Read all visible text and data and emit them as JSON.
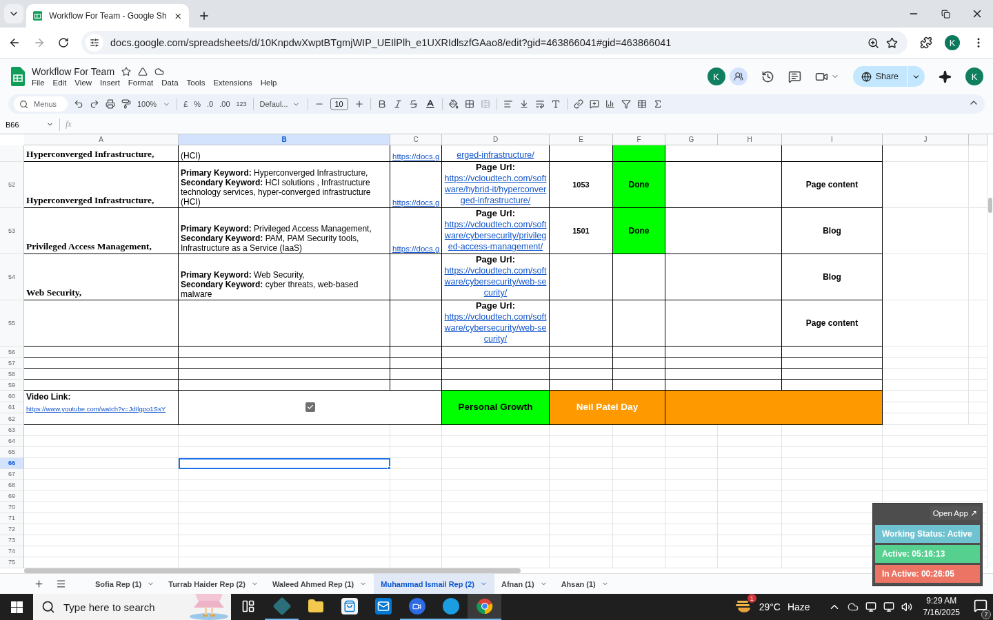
{
  "browser": {
    "tab_title": "Workflow For Team - Google Sh",
    "url": "docs.google.com/spreadsheets/d/10KnpdwXwptBTgmjWIP_UEIlPlh_e1UXRIdlszfGAao8/edit?gid=463866041#gid=463866041",
    "profile": "K"
  },
  "doc": {
    "title": "Workflow For Team",
    "menus": [
      "File",
      "Edit",
      "View",
      "Insert",
      "Format",
      "Data",
      "Tools",
      "Extensions",
      "Help"
    ],
    "collaborator": "K",
    "share": "Share",
    "profile": "K"
  },
  "toolbar": {
    "search_placeholder": "Menus",
    "zoom": "100%",
    "currency": "£",
    "percent": "%",
    "decrease_decimal": ".0",
    "increase_decimal": ".00",
    "number_format": "123",
    "font": "Defaul...",
    "font_size": "10"
  },
  "formula_bar": {
    "cell_ref": "B66",
    "fx": "fx"
  },
  "columns": [
    {
      "label": "A",
      "selected": false
    },
    {
      "label": "B",
      "selected": true
    },
    {
      "label": "C",
      "selected": false
    },
    {
      "label": "D",
      "selected": false
    },
    {
      "label": "E",
      "selected": false
    },
    {
      "label": "F",
      "selected": false
    },
    {
      "label": "G",
      "selected": false
    },
    {
      "label": "H",
      "selected": false
    },
    {
      "label": "I",
      "selected": false
    },
    {
      "label": "J",
      "selected": false
    }
  ],
  "rows": [
    {
      "kind": "tail",
      "selected": false,
      "title": "Hyperconverged Infrastructure,",
      "keywords": [
        "(HCI)"
      ],
      "doc_link": "https://docs.g",
      "page_url": "erged-infrastructure/",
      "status": {
        "color": "#00ff00"
      }
    },
    {
      "kind": "entry",
      "number": "52",
      "selected": false,
      "title": "Hyperconverged Infrastructure,",
      "keywords": [
        "**Primary Keyword:** Hyperconverged Infrastructure,",
        "**Secondary Keyword:** HCI solutions , Infrastructure technology services, hyper-converged infrastructure (HCI)"
      ],
      "doc_link": "https://docs.g",
      "page_url_label": "Page Url:",
      "page_url": "https://vcloudtech.com/software/hybrid-it/hyperconverged-infrastructure/",
      "word_count": "1053",
      "status": {
        "text": "Done",
        "color": "#00ff00"
      },
      "content_type": "Page content"
    },
    {
      "kind": "entry",
      "number": "53",
      "selected": false,
      "title": "Privileged Access Management,",
      "keywords": [
        "**Primary Keyword:** Privileged Access Management,",
        "**Secondary Keyword:** PAM, PAM Security tools, Infrastructure as a Service (IaaS)"
      ],
      "doc_link": "https://docs.g",
      "page_url_label": "Page Url:",
      "page_url": "https://vcloudtech.com/software/cybersecurity/privileged-access-management/",
      "word_count": "1501",
      "status": {
        "text": "Done",
        "color": "#00ff00"
      },
      "content_type": "Blog"
    },
    {
      "kind": "entry",
      "number": "54",
      "selected": false,
      "title": "Web Security,",
      "keywords": [
        "**Primary Keyword:** Web Security,",
        "**Secondary Keyword:** cyber threats, web-based malware"
      ],
      "page_url_label": "Page Url:",
      "page_url": "https://vcloudtech.com/software/cybersecurity/web-security/",
      "content_type": "Blog"
    },
    {
      "kind": "entry",
      "number": "55",
      "selected": false,
      "page_url_label": "Page Url:",
      "page_url": "https://vcloudtech.com/software/cybersecurity/web-security/",
      "content_type": "Page content"
    },
    {
      "kind": "blank",
      "number": "56",
      "selected": false
    },
    {
      "kind": "blank",
      "number": "57",
      "selected": false
    },
    {
      "kind": "blank",
      "number": "58",
      "selected": false
    },
    {
      "kind": "blank",
      "number": "59",
      "selected": false
    },
    {
      "kind": "summary",
      "number": "60",
      "selected": false
    },
    {
      "kind": "summary",
      "number": "61",
      "selected": false
    },
    {
      "kind": "summary",
      "number": "62",
      "selected": false
    },
    {
      "kind": "plain",
      "number": "63",
      "selected": false
    },
    {
      "kind": "plain",
      "number": "64",
      "selected": false
    },
    {
      "kind": "plain",
      "number": "65",
      "selected": false
    },
    {
      "kind": "plain",
      "number": "66",
      "selected": true
    },
    {
      "kind": "plain",
      "number": "67",
      "selected": false
    },
    {
      "kind": "plain",
      "number": "68",
      "selected": false
    },
    {
      "kind": "plain",
      "number": "69",
      "selected": false
    },
    {
      "kind": "plain",
      "number": "70",
      "selected": false
    },
    {
      "kind": "plain",
      "number": "71",
      "selected": false
    },
    {
      "kind": "plain",
      "number": "72",
      "selected": false
    },
    {
      "kind": "plain",
      "number": "73",
      "selected": false
    },
    {
      "kind": "plain",
      "number": "74",
      "selected": false
    },
    {
      "kind": "plain",
      "number": "75",
      "selected": false
    }
  ],
  "summary": {
    "label": "Video Link:",
    "video_url": "https://www.youtube.com/watch?v=JdIlgpo1SsY",
    "checked": true,
    "tags": [
      {
        "text": "Personal Growth",
        "color": "#00ff00"
      },
      {
        "text": "Neil Patel Day",
        "color": "#ff9900"
      }
    ],
    "fill": {
      "color": "#ff9900"
    }
  },
  "sheet_tabs": [
    {
      "label": "Sofia Rep (1)",
      "selected": false
    },
    {
      "label": "Turrab Haider Rep (2)",
      "selected": false
    },
    {
      "label": "Waleed Ahmed Rep (1)",
      "selected": false
    },
    {
      "label": "Muhammad Ismail Rep (2)",
      "selected": true
    },
    {
      "label": "Afnan (1)",
      "selected": false
    },
    {
      "label": "Ahsan (1)",
      "selected": false
    }
  ],
  "tracker": {
    "open_app": "Open App ↗",
    "lines": [
      {
        "text": "Working Status: Active",
        "color": "#6fc2cf"
      },
      {
        "text": "Active: 05:16:13",
        "color": "#55d08f"
      },
      {
        "text": "In Active: 00:26:05",
        "color": "#ec7464"
      }
    ]
  },
  "taskbar": {
    "search_placeholder": "Type here to search",
    "weather_badge": "1",
    "temperature": "29°C",
    "condition": "Haze",
    "time": "9:29 AM",
    "date": "7/16/2025",
    "notifications": "7"
  }
}
